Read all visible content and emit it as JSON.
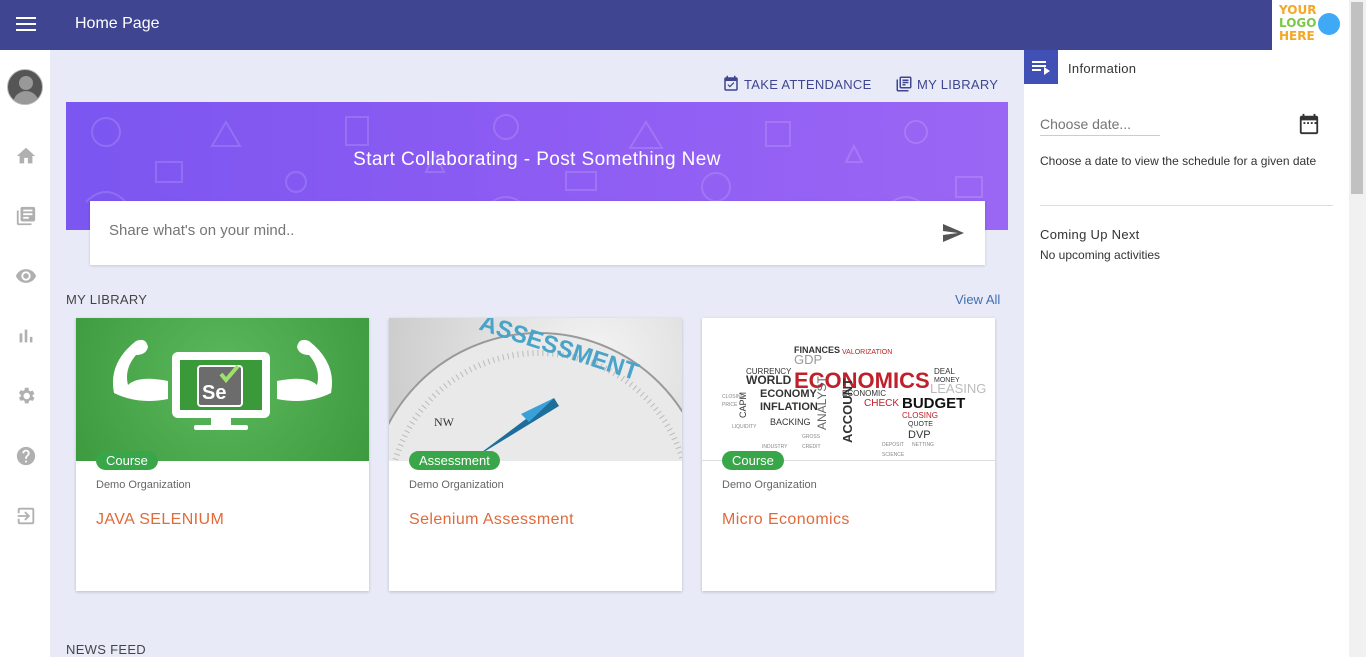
{
  "header": {
    "title": "Home Page",
    "logo": {
      "line1": "YOUR",
      "line2": "LOGO",
      "line3": "HERE"
    }
  },
  "sidebar": {
    "items": [
      {
        "icon": "home-icon"
      },
      {
        "icon": "library-icon"
      },
      {
        "icon": "eye-icon"
      },
      {
        "icon": "bar-chart-icon"
      },
      {
        "icon": "gear-icon"
      },
      {
        "icon": "help-icon"
      },
      {
        "icon": "logout-icon"
      }
    ]
  },
  "actions": {
    "take_attendance": "TAKE ATTENDANCE",
    "my_library": "MY LIBRARY"
  },
  "hero": {
    "title": "Start Collaborating - Post Something New",
    "placeholder": "Share what's on your mind.."
  },
  "library": {
    "label": "MY LIBRARY",
    "view_all": "View All",
    "cards": [
      {
        "badge": "Course",
        "org": "Demo Organization",
        "title": "JAVA SELENIUM"
      },
      {
        "badge": "Assessment",
        "org": "Demo Organization",
        "title": "Selenium Assessment"
      },
      {
        "badge": "Course",
        "org": "Demo Organization",
        "title": "Micro Economics"
      }
    ]
  },
  "news_feed": {
    "label": "NEWS FEED"
  },
  "info_panel": {
    "title": "Information",
    "date_placeholder": "Choose date...",
    "help_text": "Choose a date to view the schedule for a given date",
    "coming_up_title": "Coming Up Next",
    "coming_up_body": "No upcoming activities"
  },
  "images": {
    "selenium_badge": "Se",
    "assessment_word": "ASSESSMENT",
    "compass_nw": "NW",
    "economics_words": [
      "FINANCES",
      "GDP",
      "VALORIZATION",
      "CURRENCY",
      "WORLD",
      "ECONOMICS",
      "DEAL",
      "MONEY",
      "ECONOMY",
      "ECONOMIC",
      "LEASING",
      "INFLATION",
      "CHECK",
      "BUDGET",
      "BACKING",
      "ANALYST",
      "ACCOUNT",
      "CLOSING",
      "QUOTE",
      "DVP",
      "CAPM"
    ]
  },
  "colors": {
    "header_bg": "#3f4591",
    "accent": "#3f4591",
    "badge": "#3aa64a",
    "card_title": "#e06a3a",
    "hero": "#8d5cf3"
  }
}
